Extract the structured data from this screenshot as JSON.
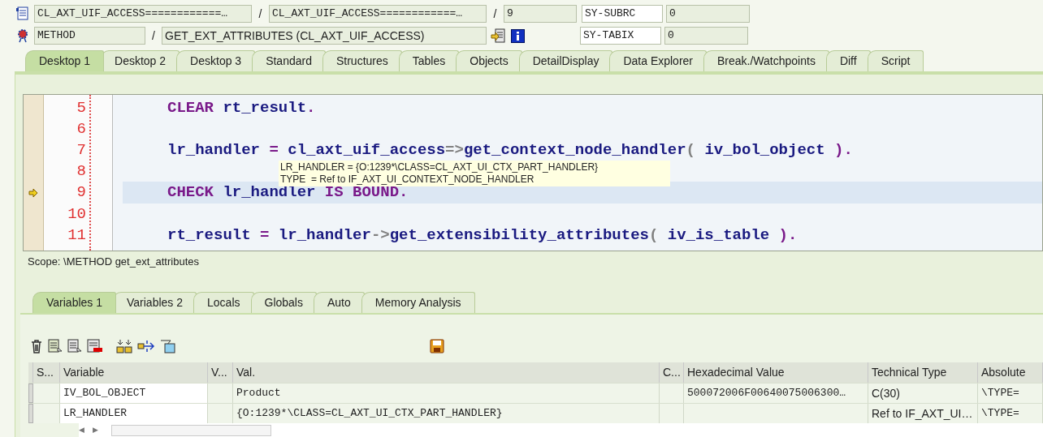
{
  "header": {
    "separator": "/",
    "row_1": {
      "program": "CL_AXT_UIF_ACCESS============…",
      "include": "CL_AXT_UIF_ACCESS============…",
      "line": "9",
      "sysvar_name": "SY-SUBRC",
      "sysvar_value": "0"
    },
    "row_2": {
      "event_type": "METHOD",
      "event": "GET_EXT_ATTRIBUTES (CL_AXT_UIF_ACCESS)",
      "sysvar_name": "SY-TABIX",
      "sysvar_value": "0"
    }
  },
  "desktop_tabs": [
    {
      "label": "Desktop 1",
      "selected": true
    },
    {
      "label": "Desktop 2",
      "selected": false
    },
    {
      "label": "Desktop 3",
      "selected": false
    },
    {
      "label": "Standard",
      "selected": false
    },
    {
      "label": "Structures",
      "selected": false
    },
    {
      "label": "Tables",
      "selected": false
    },
    {
      "label": "Objects",
      "selected": false
    },
    {
      "label": "DetailDisplay",
      "selected": false
    },
    {
      "label": "Data Explorer",
      "selected": false
    },
    {
      "label": "Break./Watchpoints",
      "selected": false
    },
    {
      "label": "Diff",
      "selected": false
    },
    {
      "label": "Script",
      "selected": false
    }
  ],
  "code": {
    "lines": [
      {
        "number": "5",
        "current": false,
        "tokens": [
          {
            "text": "CLEAR",
            "kind": "keyword"
          },
          {
            "text": " rt_result",
            "kind": "ident"
          },
          {
            "text": ".",
            "kind": "keyword"
          }
        ]
      },
      {
        "number": "6",
        "current": false
      },
      {
        "number": "7",
        "current": false,
        "tokens": [
          {
            "text": "lr_handler",
            "kind": "ident"
          },
          {
            "text": " = ",
            "kind": "keyword"
          },
          {
            "text": "cl_axt_uif_access",
            "kind": "ident"
          },
          {
            "text": "=>",
            "kind": "op"
          },
          {
            "text": "get_context_node_handler",
            "kind": "ident"
          },
          {
            "text": "( ",
            "kind": "op"
          },
          {
            "text": "iv_bol_object",
            "kind": "ident"
          },
          {
            "text": " ).",
            "kind": "keyword"
          }
        ]
      },
      {
        "number": "8",
        "current": false
      },
      {
        "number": "9",
        "current": true,
        "tokens": [
          {
            "text": "CHECK",
            "kind": "keyword"
          },
          {
            "text": " lr_handler",
            "kind": "ident"
          },
          {
            "text": " IS BOUND.",
            "kind": "keyword"
          }
        ]
      },
      {
        "number": "10",
        "current": false
      },
      {
        "number": "11",
        "current": false,
        "tokens": [
          {
            "text": "rt_result",
            "kind": "ident"
          },
          {
            "text": " = ",
            "kind": "keyword"
          },
          {
            "text": "lr_handler",
            "kind": "ident"
          },
          {
            "text": "->",
            "kind": "op"
          },
          {
            "text": "get_extensibility_attributes",
            "kind": "ident"
          },
          {
            "text": "( ",
            "kind": "op"
          },
          {
            "text": "iv_is_table",
            "kind": "ident"
          },
          {
            "text": " ).",
            "kind": "keyword"
          }
        ]
      }
    ],
    "tooltip": [
      "LR_HANDLER = {O:1239*\\CLASS=CL_AXT_UI_CTX_PART_HANDLER}",
      "TYPE  = Ref to IF_AXT_UI_CONTEXT_NODE_HANDLER"
    ]
  },
  "scope": "Scope: \\METHOD get_ext_attributes",
  "variable_tabs": [
    {
      "label": "Variables 1",
      "selected": true
    },
    {
      "label": "Variables 2",
      "selected": false
    },
    {
      "label": "Locals",
      "selected": false
    },
    {
      "label": "Globals",
      "selected": false
    },
    {
      "label": "Auto",
      "selected": false
    },
    {
      "label": "Memory Analysis",
      "selected": false
    }
  ],
  "scroll_arrows": [
    "◀",
    "▶"
  ],
  "table": {
    "columns": [
      "S...",
      "Variable",
      "V...",
      "Val.",
      "C...",
      "Hexadecimal Value",
      "Technical Type",
      "Absolute"
    ],
    "rows": [
      [
        "",
        "IV_BOL_OBJECT",
        "",
        "Product",
        "",
        "500072006F00640075006300…",
        "C(30)",
        "\\TYPE="
      ],
      [
        "",
        "LR_HANDLER",
        "",
        "{O:1239*\\CLASS=CL_AXT_UI_CTX_PART_HANDLER}",
        "",
        "",
        "Ref to IF_AXT_UI…",
        "\\TYPE="
      ]
    ]
  }
}
